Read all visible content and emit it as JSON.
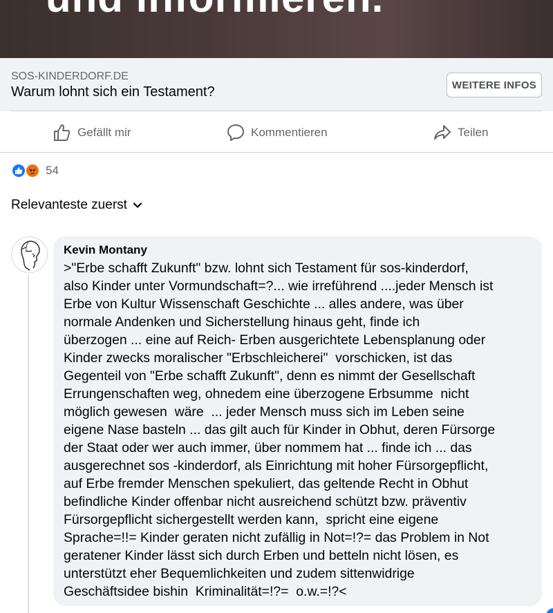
{
  "hero": {
    "text": "und informieren."
  },
  "link_preview": {
    "domain": "SOS-KINDERDORF.DE",
    "title": "Warum lohnt sich ein Testament?",
    "button_label": "WEITERE INFOS"
  },
  "actions": {
    "like": "Gefällt mir",
    "comment": "Kommentieren",
    "share": "Teilen"
  },
  "reactions": {
    "count": "54",
    "types": [
      "like-icon",
      "angry-icon"
    ],
    "colors": {
      "like": "#1877f2",
      "angry": "#e9710f"
    }
  },
  "sort": {
    "label": "Relevanteste zuerst"
  },
  "comment": {
    "author": "Kevin Montany",
    "text": ">\"Erbe schafft Zukunft\" bzw. lohnt sich Testament für sos-kinderdorf,\nalso Kinder unter Vormundschaft=?... wie irreführend ....jeder Mensch ist\nErbe von Kultur Wissenschaft Geschichte ... alles andere, was über\nnormale Andenken und Sicherstellung hinaus geht, finde ich\nüberzogen ... eine auf Reich- Erben ausgerichtete Lebensplanung oder\nKinder zwecks moralischer \"Erbschleicherei\"  vorschicken, ist das\nGegenteil von \"Erbe schafft Zukunft\", denn es nimmt der Gesellschaft\nErrungenschaften weg, ohnedem eine überzogene Erbsumme  nicht\nmöglich gewesen  wäre  ... jeder Mensch muss sich im Leben seine\neigene Nase basteln ... das gilt auch für Kinder in Obhut, deren Fürsorge\nder Staat oder wer auch immer, über nommem hat ... finde ich ... das\nausgerechnet sos -kinderdorf, als Einrichtung mit hoher Fürsorgepflicht,\nauf Erbe fremder Menschen spekuliert, das geltende Recht in Obhut\nbefindliche Kinder offenbar nicht ausreichend schützt bzw. präventiv\nFürsorgepflicht sichergestellt werden kann,  spricht eine eigene\nSprache=!!= Kinder geraten nicht zufällig in Not=!?= das Problem in Not\ngeratener Kinder lässt sich durch Erben und betteln nicht lösen, es\nunterstützt eher Bequemlichkeiten und zudem sittenwidrige\nGeschäftsidee bishin  Kriminalität=!?=  o.w.=!?<"
  }
}
